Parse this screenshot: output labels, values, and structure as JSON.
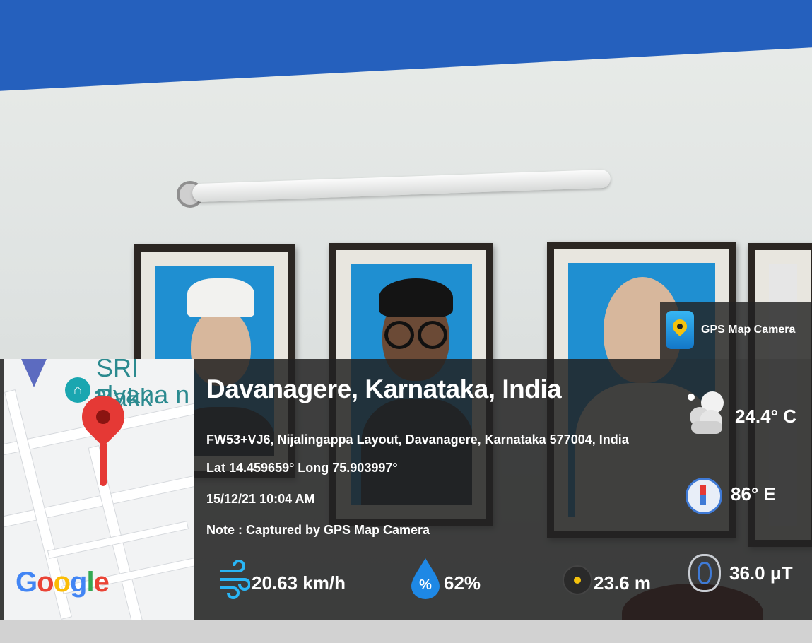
{
  "branding": {
    "app_name": "GPS Map Camera",
    "logo_icon": "gps-map-camera-logo-icon"
  },
  "map": {
    "visible_label_line1": "SRI Bakk",
    "visible_label_line2": "alyana n",
    "attribution": "Google",
    "pin_icon": "location-pin-icon",
    "google_colors": [
      "#4285F4",
      "#EA4335",
      "#FBBC05",
      "#4285F4",
      "#34A853",
      "#EA4335"
    ]
  },
  "location": {
    "title": "Davanagere, Karnataka, India",
    "address": "FW53+VJ6, Nijalingappa Layout, Davanagere, Karnataka 577004, India",
    "coordinates": "Lat 14.459659° Long 75.903997°",
    "datetime": "15/12/21 10:04 AM",
    "note": "Note : Captured by GPS Map Camera"
  },
  "metrics": {
    "wind": {
      "value": "20.63 km/h",
      "icon": "wind-icon"
    },
    "humidity": {
      "value": "62%",
      "icon": "humidity-drop-icon"
    },
    "altitude": {
      "value": "23.6 m",
      "icon": "altitude-icon"
    },
    "temperature": {
      "value": "24.4° C",
      "icon": "cloud-weather-icon"
    },
    "direction": {
      "value": "86° E",
      "icon": "compass-icon"
    },
    "magnetic": {
      "value": "36.0 μT",
      "icon": "magnet-field-icon"
    }
  },
  "colors": {
    "overlay": "#222222",
    "ceiling": "#2560bd",
    "portrait_background": "#1f8fd1"
  }
}
